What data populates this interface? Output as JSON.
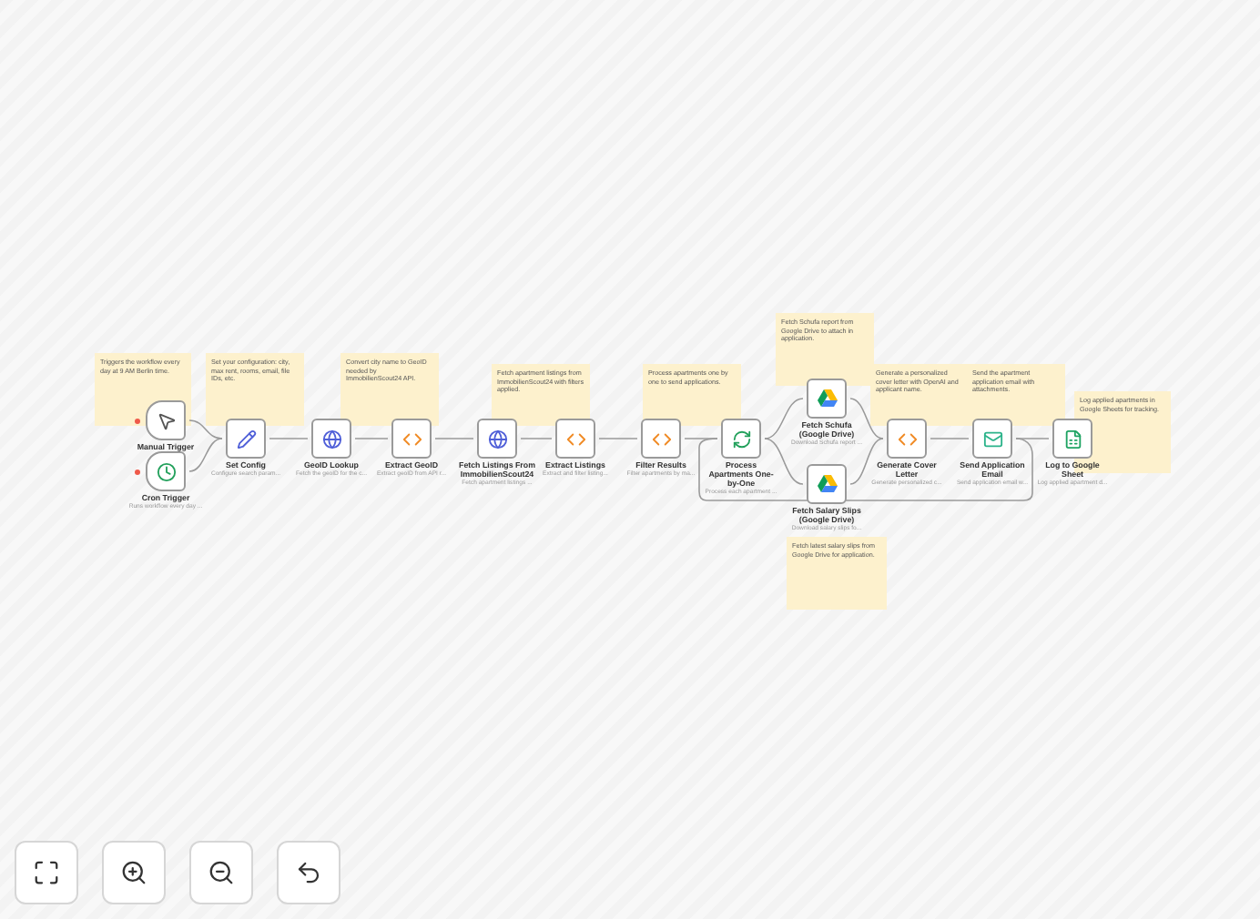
{
  "sticky_notes": [
    {
      "text": "Triggers the workflow every day at 9 AM Berlin time."
    },
    {
      "text": "Set your configuration: city, max rent, rooms, email, file IDs, etc."
    },
    {
      "text": "Convert city name to GeoID needed by ImmobilienScout24 API."
    },
    {
      "text": "Fetch apartment listings from ImmobilienScout24 with filters applied."
    },
    {
      "text": "Process apartments one by one to send applications."
    },
    {
      "text": "Fetch Schufa report from Google Drive to attach in application."
    },
    {
      "text": "Generate a personalized cover letter with OpenAI and applicant name."
    },
    {
      "text": "Send the apartment application email with attachments."
    },
    {
      "text": "Log applied apartments in Google Sheets for tracking."
    },
    {
      "text": "Fetch latest salary slips from Google Drive for application."
    }
  ],
  "nodes": [
    {
      "kind": "manual",
      "label": "Manual Trigger"
    },
    {
      "kind": "schedule",
      "label": "Cron Trigger",
      "subtitle": "Runs workflow every day ..."
    },
    {
      "kind": "set",
      "label": "Set Config",
      "subtitle": "Configure search param..."
    },
    {
      "kind": "http",
      "label": "GeoID Lookup",
      "subtitle": "Fetch the geoID for the c..."
    },
    {
      "kind": "code",
      "label": "Extract GeoID",
      "subtitle": "Extract geoID from API r..."
    },
    {
      "kind": "http",
      "label": "Fetch Listings From ImmobilienScout24",
      "subtitle": "Fetch apartment listings ..."
    },
    {
      "kind": "code",
      "label": "Extract Listings",
      "subtitle": "Extract and filter listing..."
    },
    {
      "kind": "code",
      "label": "Filter Results",
      "subtitle": "Filter apartments by ma..."
    },
    {
      "kind": "split",
      "label": "Process Apartments One-by-One",
      "subtitle": "Process each apartment ..."
    },
    {
      "kind": "drive",
      "label": "Fetch Schufa (Google Drive)",
      "subtitle": "Download Schufa report ..."
    },
    {
      "kind": "drive",
      "label": "Fetch Salary Slips (Google Drive)",
      "subtitle": "Download salary slips fo..."
    },
    {
      "kind": "code",
      "label": "Generate Cover Letter",
      "subtitle": "Generate personalized c..."
    },
    {
      "kind": "email",
      "label": "Send Application Email",
      "subtitle": "Send application email w..."
    },
    {
      "kind": "sheets",
      "label": "Log to Google Sheet",
      "subtitle": "Log applied apartment d..."
    }
  ],
  "canvas_controls": [
    {
      "kind": "fit"
    },
    {
      "kind": "zoom_in"
    },
    {
      "kind": "zoom_out"
    },
    {
      "kind": "undo"
    }
  ]
}
